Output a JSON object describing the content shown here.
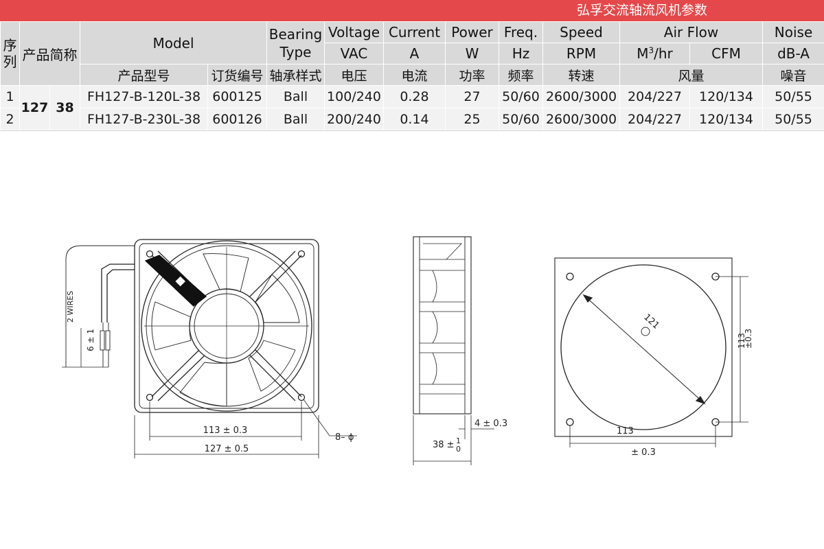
{
  "banner": {
    "title": "弘孚交流轴流风机参数"
  },
  "header": {
    "seq": "序列",
    "abbr": "产品简称",
    "model": "Model",
    "bearing": "Bearing Type",
    "voltage": "Voltage",
    "current": "Current",
    "power": "Power",
    "freq": "Freq.",
    "speed": "Speed",
    "airflow": "Air Flow",
    "noise": "Noise"
  },
  "units": {
    "voltage": "VAC",
    "current": "A",
    "power": "W",
    "freq": "Hz",
    "speed": "RPM",
    "airflow_m3_base": "M",
    "airflow_m3_sup": "3",
    "airflow_m3_rest": "/hr",
    "airflow_cfm": "CFM",
    "noise": "dB-A"
  },
  "zh": {
    "model": "产品型号",
    "order": "订货编号",
    "bearing": "轴承样式",
    "voltage": "电压",
    "current": "电流",
    "power": "功率",
    "freq": "频率",
    "speed": "转速",
    "airflow": "风量",
    "noise": "噪音"
  },
  "product": {
    "size": "127",
    "thickness": "38"
  },
  "rows": [
    {
      "seq": "1",
      "model": "FH127-B-120L-38",
      "order": "600125",
      "bearing": "Ball",
      "voltage": "100/240",
      "current": "0.28",
      "power": "27",
      "freq": "50/60",
      "speed": "2600/3000",
      "m3": "204/227",
      "cfm": "120/134",
      "noise": "50/55"
    },
    {
      "seq": "2",
      "model": "FH127-B-230L-38",
      "order": "600126",
      "bearing": "Ball",
      "voltage": "200/240",
      "current": "0.14",
      "power": "25",
      "freq": "50/60",
      "speed": "2600/3000",
      "m3": "204/227",
      "cfm": "120/134",
      "noise": "50/55"
    }
  ],
  "drawing": {
    "wires": "2 WIRES",
    "lead_tol": "6 ± 1",
    "hole_pitch": "113 ± 0.3",
    "outer_size": "127 ± 0.5",
    "hole": "8– ϕ",
    "thick_a": "4 ± 0.3",
    "thick_b_main": "38 ±",
    "thick_b_up": "1",
    "thick_b_down": "0",
    "circle_dia": "121",
    "back_v_num": "113",
    "back_v_tol": "±0.3",
    "back_h_num": "113",
    "back_h_tol": "± 0.3"
  },
  "colors": {
    "banner": "#e5484a",
    "header_bg": "#d9d9d9",
    "row_bg": "#f2f2f2"
  }
}
